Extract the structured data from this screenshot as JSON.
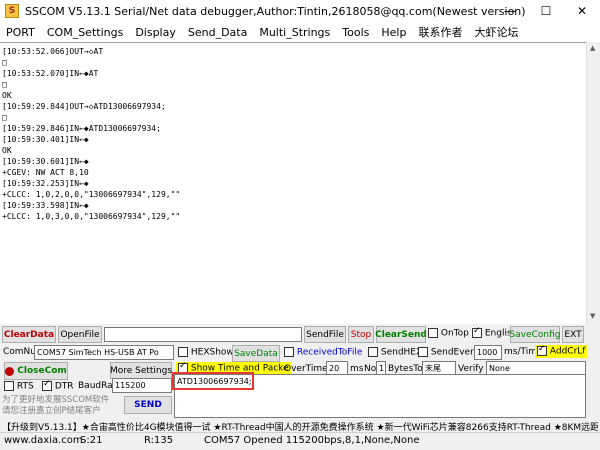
{
  "window": {
    "title": "SSCOM V5.13.1 Serial/Net data debugger,Author:Tintin,2618058@qq.com(Newest version)"
  },
  "menu": [
    "PORT",
    "COM_Settings",
    "Display",
    "Send_Data",
    "Multi_Strings",
    "Tools",
    "Help",
    "联系作者",
    "大虾论坛"
  ],
  "log": [
    {
      "text": "[10:53:52.066]OUT→◇AT"
    },
    {
      "text": "□"
    },
    {
      "text": "[10:53:52.070]IN←◆AT"
    },
    {
      "text": "□"
    },
    {
      "text": "OK"
    },
    {
      "text": ""
    },
    {
      "text": "[10:59:29.844]OUT→◇ATD13006697934;"
    },
    {
      "text": "□"
    },
    {
      "text": "[10:59:29.846]IN←◆ATD13006697934;"
    },
    {
      "text": "[10:59:30.401]IN←◆"
    },
    {
      "text": "OK"
    },
    {
      "text": ""
    },
    {
      "text": "[10:59:30.601]IN←◆"
    },
    {
      "text": "+CGEV: NW ACT 8,10"
    },
    {
      "text": ""
    },
    {
      "text": "[10:59:32.253]IN←◆"
    },
    {
      "text": "+CLCC: 1,0,2,0,0,\"13006697934\",129,\"\""
    },
    {
      "text": ""
    },
    {
      "text": "[10:59:33.598]IN←◆"
    },
    {
      "text": "+CLCC: 1,0,3,0,0,\"13006697934\",129,\"\""
    }
  ],
  "toolbar": {
    "clear_data": "ClearData",
    "open_file": "OpenFile",
    "send_file": "SendFile",
    "stop": "Stop",
    "clear_send": "ClearSend",
    "on_top": "OnTop",
    "english": "English",
    "save_config": "SaveConfig",
    "ext": "EXT"
  },
  "settings": {
    "com_num_label": "ComNum",
    "com_port": "COM57 SimTech HS-USB AT Po",
    "hex_show": "HEXShow",
    "save_data": "SaveData",
    "received_to_file": "ReceivedToFile",
    "send_hex": "SendHEX",
    "send_every": "SendEvery:",
    "send_every_value": "1000",
    "send_every_unit": "ms/Tim",
    "add_crlf": "AddCrLf",
    "close_com": "CloseCom",
    "more_settings": "More Settings",
    "show_time": "Show Time and Packe",
    "over_time": "OverTime:",
    "over_time_value": "20",
    "over_time_unit": "ms",
    "no": "No",
    "no_value": "1",
    "bytes_to": "BytesTo",
    "end_value": "末尾",
    "verify": "Verify",
    "verify_value": "None",
    "rts": "RTS",
    "dtr": "DTR",
    "baud_label": "BaudRat",
    "baud_value": "115200",
    "send_text": "ATD13006697934;",
    "send_button": "SEND",
    "promo": "为了更好地发展SSCOM软件\n请您注册嘉立创P结尾客户"
  },
  "ticker": "【升级到V5.13.1】★合宙高性价比4G模块值得一试 ★RT-Thread中国人的开源免费操作系统 ★新一代WiFi芯片兼容8266支持RT-Thread ★8KM远距",
  "status": {
    "site": "www.daxia.com",
    "s": "S:21",
    "r": "R:135",
    "port": "COM57 Opened  115200bps,8,1,None,None"
  },
  "colors": {
    "highlight_box": "#e53935",
    "add_crlf_bg": "#ffff00",
    "show_time_bg": "#ffff00",
    "ticker_blue": "#0000cc",
    "close_com_green": "#008000",
    "clear_red": "#c00000"
  }
}
